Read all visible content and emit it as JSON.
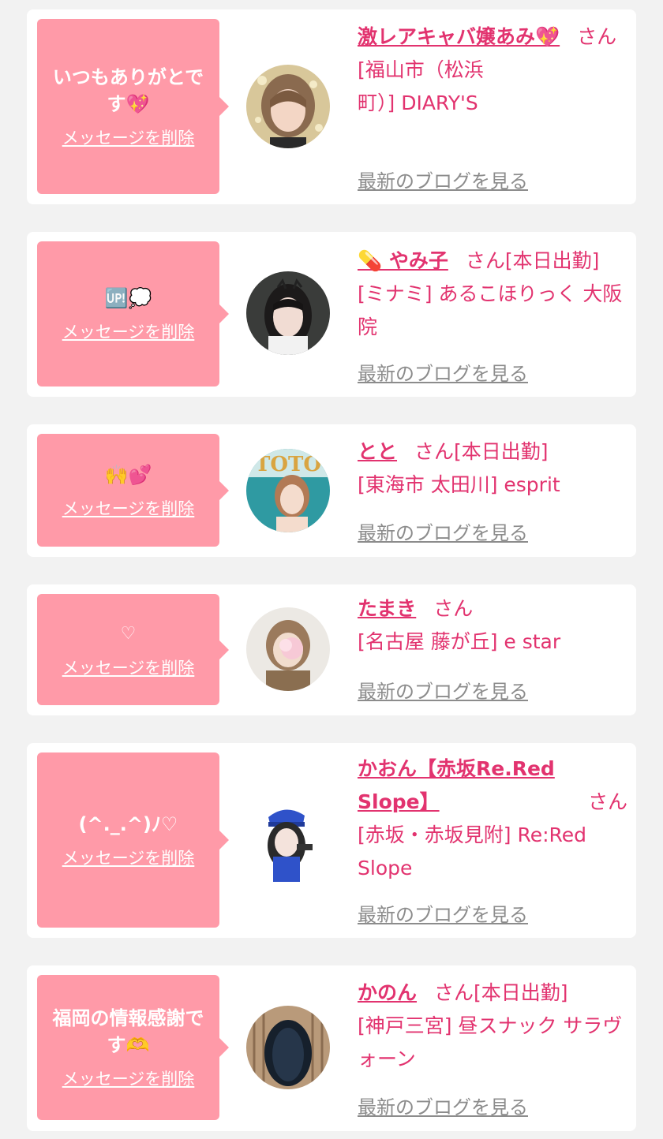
{
  "cards": [
    {
      "message": "いつもありがとです",
      "message_emoji": "💖",
      "delete_label": "メッセージを削除",
      "name": "激レアキャバ嬢あみ💖",
      "honorific": "さん",
      "shop": "[福山市（松浜町）] DIARY'S",
      "blog_label": "最新のブログを見る"
    },
    {
      "message": "🆙💭",
      "delete_label": "メッセージを削除",
      "name": "💊 やみ子",
      "honorific": "さん",
      "status": "[本日出勤]",
      "shop": "[ミナミ] あるこほりっく 大阪院",
      "blog_label": "最新のブログを見る"
    },
    {
      "message": "🙌💕",
      "delete_label": "メッセージを削除",
      "name": "とと",
      "honorific": "さん",
      "status": "[本日出勤]",
      "shop": "[東海市 太田川] esprit",
      "blog_label": "最新のブログを見る"
    },
    {
      "message": "♡",
      "delete_label": "メッセージを削除",
      "name": "たまき",
      "honorific": "さん",
      "shop": "[名古屋 藤が丘] e star",
      "blog_label": "最新のブログを見る"
    },
    {
      "message": "(^._.^)ﾉ♡",
      "delete_label": "メッセージを削除",
      "name": "かおん【赤坂Re.Red Slope】",
      "honorific": "さん",
      "shop": "[赤坂・赤坂見附] Re:Red Slope",
      "blog_label": "最新のブログを見る"
    },
    {
      "message": "福岡の情報感謝です",
      "message_emoji": "🫶",
      "delete_label": "メッセージを削除",
      "name": "かのん",
      "honorific": "さん",
      "status": "[本日出勤]",
      "shop": "[神戸三宮] 昼スナック サラヴォーン",
      "blog_label": "最新のブログを見る"
    }
  ],
  "colors": {
    "bubble": "#ff9aa8",
    "name": "#e2336f",
    "link_gray": "#8c8c8c",
    "background": "#f2f2f2"
  }
}
